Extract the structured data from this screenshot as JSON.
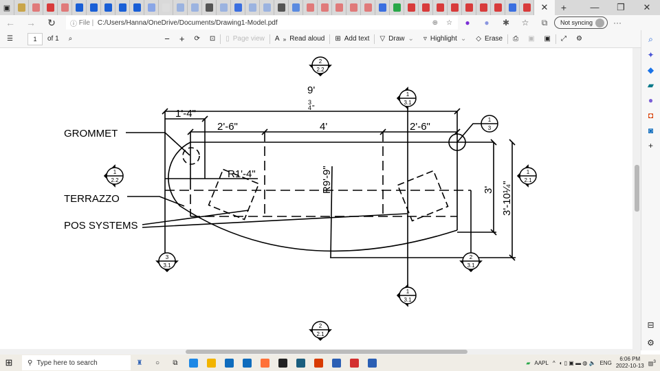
{
  "browser": {
    "tab_colors": [
      "#c9a54a",
      "#e07a7a",
      "#d83b3b",
      "#e07a7a",
      "#1a5fd6",
      "#1a5fd6",
      "#1a5fd6",
      "#1a5fd6",
      "#1a5fd6",
      "#8aa6e6",
      "#ddd",
      "#9bb3e0",
      "#9bb3e0",
      "#555",
      "#9bb3e0",
      "#3b6fe0",
      "#9bb3e0",
      "#9bb3e0",
      "#555",
      "#5b8be0",
      "#e07a7a",
      "#e07a7a",
      "#e07a7a",
      "#e07a7a",
      "#e07a7a",
      "#3b6fe0",
      "#2aa84a",
      "#d83b3b",
      "#d83b3b",
      "#d83b3b",
      "#d83b3b",
      "#d83b3b",
      "#d83b3b",
      "#d83b3b",
      "#3b6fe0",
      "#d83b3b"
    ],
    "active_tab_close": "✕",
    "new_tab": "+",
    "file_label": "File",
    "url": "C:/Users/Hanna/OneDrive/Documents/Drawing1-Model.pdf",
    "sync_label": "Not syncing"
  },
  "toolbar": {
    "page_number": "1",
    "page_count": "of 1",
    "page_view": "Page view",
    "read_aloud": "Read aloud",
    "add_text": "Add text",
    "draw": "Draw",
    "highlight": "Highlight",
    "erase": "Erase"
  },
  "drawing": {
    "labels": {
      "grommet": "GROMMET",
      "terrazzo": "TERRAZZO",
      "pos": "POS SYSTEMS"
    },
    "dims": {
      "overall": "9'",
      "overall_frac_num": "3",
      "overall_frac_den": "4",
      "overall_inch": "\"",
      "left": "1'-4\"",
      "seg1": "2'-6\"",
      "seg2": "4'",
      "seg3": "2'-6\"",
      "r_small": "R1'-4\"",
      "r_large": "R9'-9\"",
      "depth": "3'",
      "depth_total": "3'-10¼\""
    },
    "markers": [
      {
        "top": "2",
        "bottom": "2.2"
      },
      {
        "top": "1",
        "bottom": "3.1"
      },
      {
        "top": "1",
        "bottom": "2.2"
      },
      {
        "top": "1",
        "bottom": "2.1"
      },
      {
        "top": "3",
        "bottom": "3.1"
      },
      {
        "top": "2",
        "bottom": "3.1"
      },
      {
        "top": "1",
        "bottom": "3.1"
      },
      {
        "top": "2",
        "bottom": "2.1"
      },
      {
        "top": "1",
        "bottom": "3"
      }
    ]
  },
  "taskbar": {
    "search_placeholder": "Type here to search",
    "stock": "AAPL",
    "lang": "ENG",
    "time": "6:06 PM",
    "date": "2022-10-13",
    "notifications": "3",
    "app_colors": [
      "#1e88e5",
      "#f2b400",
      "#0f6cbd",
      "#0f6cbd",
      "#ff7139",
      "#222",
      "#1b5e7e",
      "#d83b01",
      "#2b5fb4",
      "#d32f2f",
      "#2b5fb4"
    ]
  }
}
